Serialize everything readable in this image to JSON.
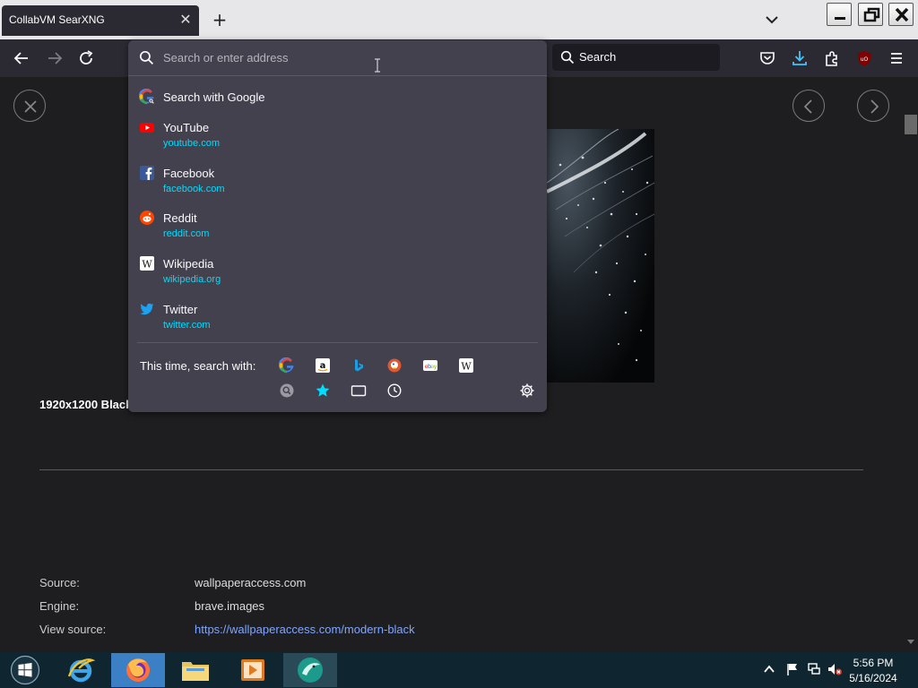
{
  "browser": {
    "tab_title": "CollabVM SearXNG",
    "tab_close_icon": "close-icon",
    "new_tab_icon": "plus-icon",
    "search_placeholder": "Search",
    "window_controls": [
      "minimize-icon",
      "restore-icon",
      "close-icon"
    ]
  },
  "urlbar": {
    "placeholder": "Search or enter address",
    "results": [
      {
        "name": "Search with Google",
        "url": "",
        "icon": "google-icon"
      },
      {
        "name": "YouTube",
        "url": "youtube.com",
        "icon": "youtube-icon"
      },
      {
        "name": "Facebook",
        "url": "facebook.com",
        "icon": "facebook-icon"
      },
      {
        "name": "Reddit",
        "url": "reddit.com",
        "icon": "reddit-icon"
      },
      {
        "name": "Wikipedia",
        "url": "wikipedia.org",
        "icon": "wikipedia-icon"
      },
      {
        "name": "Twitter",
        "url": "twitter.com",
        "icon": "twitter-icon"
      }
    ],
    "oneoff_label": "This time, search with:",
    "engines": [
      "google-icon",
      "amazon-icon",
      "bing-icon",
      "duckduckgo-icon",
      "ebay-icon",
      "wikipedia-icon"
    ],
    "modes": [
      "searxng-icon",
      "bookmarks-icon",
      "tabs-icon",
      "history-icon"
    ],
    "settings_icon": "gear-icon"
  },
  "page": {
    "image_title": "1920x1200 Black",
    "details": [
      {
        "label": "Source:",
        "value": "wallpaperaccess.com",
        "link": false
      },
      {
        "label": "Engine:",
        "value": "brave.images",
        "link": false
      },
      {
        "label": "View source:",
        "value": "https://wallpaperaccess.com/modern-black",
        "link": true
      }
    ]
  },
  "taskbar": {
    "time": "5:56 PM",
    "date": "5/16/2024",
    "apps": [
      "internet-explorer-icon",
      "firefox-icon",
      "file-explorer-icon",
      "media-player-icon",
      "app-icon"
    ]
  },
  "colors": {
    "accent_link": "#00ddff",
    "panel_bg": "#42414d",
    "toolbar_bg": "#2b2a33"
  }
}
